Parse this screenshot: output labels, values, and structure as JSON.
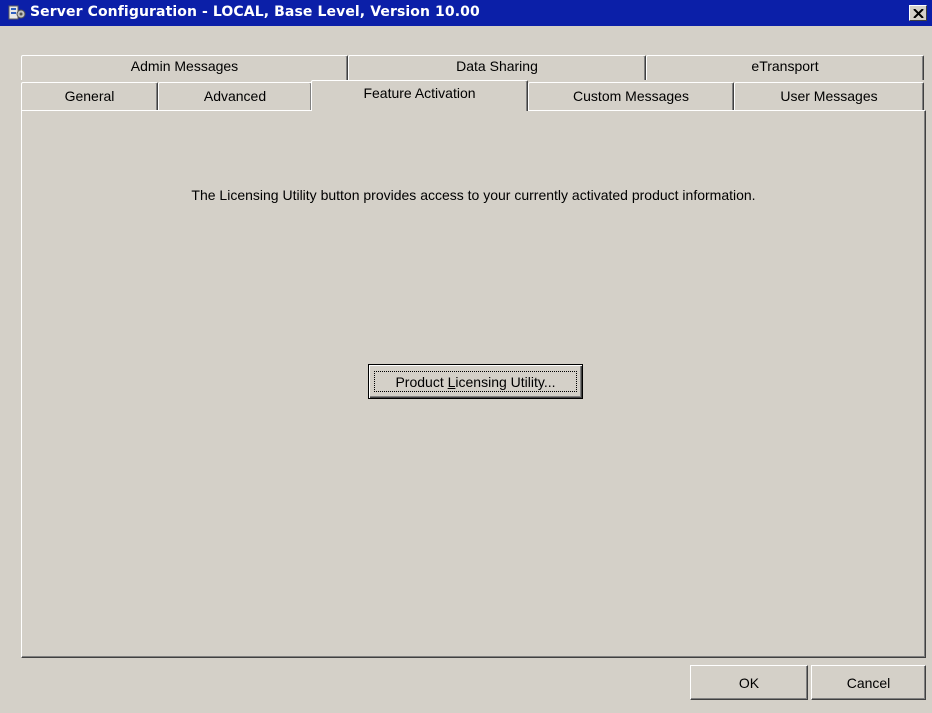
{
  "window": {
    "title": "Server Configuration - LOCAL, Base Level, Version 10.00",
    "close_label": "close",
    "colors": {
      "titlebar": "#0b1fa8",
      "face": "#d4d0c8"
    }
  },
  "tabs": {
    "row_back": [
      {
        "label": "Admin Messages"
      },
      {
        "label": "Data Sharing"
      },
      {
        "label": "eTransport"
      }
    ],
    "row_front": [
      {
        "label": "General"
      },
      {
        "label": "Advanced"
      },
      {
        "label": "Feature Activation",
        "active": true
      },
      {
        "label": "Custom Messages"
      },
      {
        "label": "User Messages"
      }
    ]
  },
  "panel": {
    "info_text": "The Licensing Utility button provides access to your currently activated product information.",
    "licensing_button": {
      "pre": "Product ",
      "mnemonic": "L",
      "post": "icensing Utility..."
    }
  },
  "footer": {
    "ok_label": "OK",
    "cancel_label": "Cancel"
  }
}
